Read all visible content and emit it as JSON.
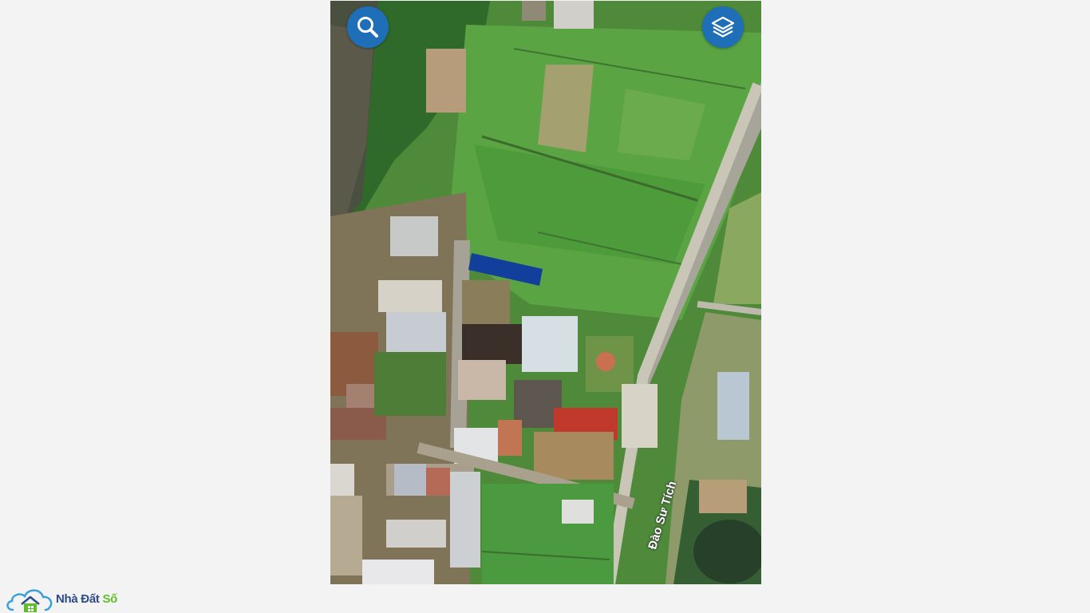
{
  "map": {
    "road_label": "Đào Sư Tích",
    "highlight_color": "#123f9c",
    "controls": {
      "search_icon": "search-icon",
      "layers_icon": "layers-icon",
      "button_color": "#1f6fb8"
    }
  },
  "brand": {
    "logo_icon": "house-cloud-logo",
    "name_part1": "Nhà Đất ",
    "name_part2": "Số",
    "name_color": "#2d4a8a",
    "accent_color": "#5cbf2a"
  }
}
